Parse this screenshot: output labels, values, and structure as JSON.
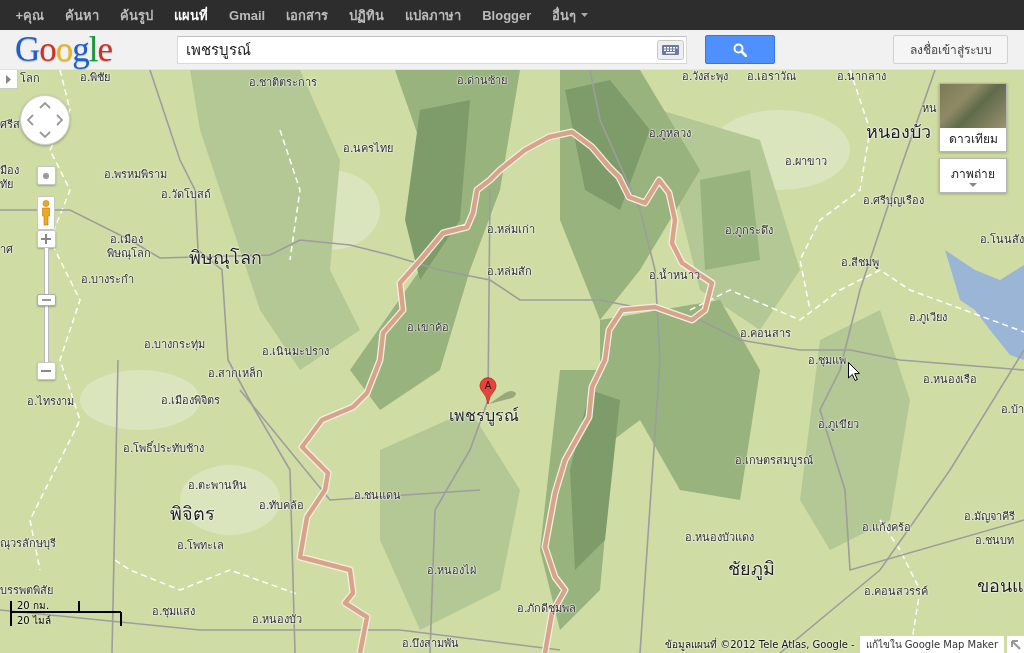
{
  "top_bar": {
    "items": [
      {
        "label": "+คุณ",
        "selected": false,
        "kind": "link"
      },
      {
        "label": "ค้นหา",
        "selected": false,
        "kind": "link"
      },
      {
        "label": "ค้นรูป",
        "selected": false,
        "kind": "link"
      },
      {
        "label": "แผนที่",
        "selected": true,
        "kind": "link"
      },
      {
        "label": "Gmail",
        "selected": false,
        "kind": "link"
      },
      {
        "label": "เอกสาร",
        "selected": false,
        "kind": "link"
      },
      {
        "label": "ปฏิทิน",
        "selected": false,
        "kind": "link"
      },
      {
        "label": "แปลภาษา",
        "selected": false,
        "kind": "link"
      },
      {
        "label": "Blogger",
        "selected": false,
        "kind": "link"
      },
      {
        "label": "อื่นๆ",
        "selected": false,
        "kind": "menu"
      }
    ]
  },
  "header": {
    "logo": "Google",
    "search": {
      "value": "เพชรบูรณ์"
    },
    "sign_in": "ลงชื่อเข้าสู่ระบบ"
  },
  "map": {
    "labels": [
      {
        "text": "โลก",
        "kind": "district"
      },
      {
        "text": "อ.พิชัย",
        "kind": "district"
      },
      {
        "text": "อ.ชาติตระการ",
        "kind": "district"
      },
      {
        "text": "อ.ด่านซ้าย",
        "kind": "district"
      },
      {
        "text": "อ.วังสะพุง",
        "kind": "district"
      },
      {
        "text": "อ.เอราวัณ",
        "kind": "district"
      },
      {
        "text": "อ.นากลาง",
        "kind": "district"
      },
      {
        "text": "หน",
        "kind": "district"
      },
      {
        "text": "ศรีส",
        "kind": "district"
      },
      {
        "text": "อ.ภูหลวง",
        "kind": "district"
      },
      {
        "text": "หนองบัว",
        "kind": "province"
      },
      {
        "text": "อ.นครไทย",
        "kind": "district"
      },
      {
        "text": "อ.ผาขาว",
        "kind": "district"
      },
      {
        "text": "มือง",
        "kind": "district"
      },
      {
        "text": "อ.พรหมพิราม",
        "kind": "district"
      },
      {
        "text": "ทัย",
        "kind": "district"
      },
      {
        "text": "อ.วัดโบสถ์",
        "kind": "district"
      },
      {
        "text": "อ.ศรีบุญเรือง",
        "kind": "district"
      },
      {
        "text": "อ.หล่มเก่า",
        "kind": "district"
      },
      {
        "text": "อ.ภูกระดึง",
        "kind": "district"
      },
      {
        "text": "อ.เมือง",
        "kind": "district"
      },
      {
        "text": "อ.โนนสัง",
        "kind": "district"
      },
      {
        "text": "าศ",
        "kind": "district"
      },
      {
        "text": "พิษณุโลก",
        "kind": "district"
      },
      {
        "text": "พิษณุโลก",
        "kind": "province"
      },
      {
        "text": "อ.สีชมพู",
        "kind": "district"
      },
      {
        "text": "อ.บางระกำ",
        "kind": "district"
      },
      {
        "text": "อ.หล่มสัก",
        "kind": "district"
      },
      {
        "text": "อ.น้ำหนาว",
        "kind": "district"
      },
      {
        "text": "อ.ภูเวียง",
        "kind": "district"
      },
      {
        "text": "อ.เขาค้อ",
        "kind": "district"
      },
      {
        "text": "อ.คอนสาร",
        "kind": "district"
      },
      {
        "text": "อ.บางกระทุ่ม",
        "kind": "district"
      },
      {
        "text": "อ.เนินมะปราง",
        "kind": "district"
      },
      {
        "text": "อ.ชุมแพ",
        "kind": "district"
      },
      {
        "text": "อ.สากเหล็ก",
        "kind": "district"
      },
      {
        "text": "อ.หนองเรือ",
        "kind": "district"
      },
      {
        "text": "อ.ไทรงาม",
        "kind": "district"
      },
      {
        "text": "อ.เมืองพิจิตร",
        "kind": "district"
      },
      {
        "text": "เพชรบูรณ์",
        "kind": "city"
      },
      {
        "text": "อ.บ้า",
        "kind": "district"
      },
      {
        "text": "อ.ภูเขียว",
        "kind": "district"
      },
      {
        "text": "อ.โพธิ์ประทับช้าง",
        "kind": "district"
      },
      {
        "text": "อ.เกษตรสมบูรณ์",
        "kind": "district"
      },
      {
        "text": "อ.ตะพานหิน",
        "kind": "district"
      },
      {
        "text": "อ.ชนแดน",
        "kind": "district"
      },
      {
        "text": "พิจิตร",
        "kind": "province"
      },
      {
        "text": "อ.ทับคล้อ",
        "kind": "district"
      },
      {
        "text": "อ.มัญจาคีรี",
        "kind": "district"
      },
      {
        "text": "อ.แก้งคร้อ",
        "kind": "district"
      },
      {
        "text": "ณุวรลักษบุรี",
        "kind": "district"
      },
      {
        "text": "อ.โพทะเล",
        "kind": "district"
      },
      {
        "text": "อ.หนองบัวแดง",
        "kind": "district"
      },
      {
        "text": "อ.ชนบท",
        "kind": "district"
      },
      {
        "text": "อ.หนองไผ่",
        "kind": "district"
      },
      {
        "text": "ชัยภูมิ",
        "kind": "province"
      },
      {
        "text": "บรรพตพิสัย",
        "kind": "district"
      },
      {
        "text": "อ.คอนสวรรค์",
        "kind": "district"
      },
      {
        "text": "ขอนแ",
        "kind": "province"
      },
      {
        "text": "อ.ชุมแสง",
        "kind": "district"
      },
      {
        "text": "อ.ภักดีชุมพล",
        "kind": "district"
      },
      {
        "text": "อ.หนองบัว",
        "kind": "district"
      },
      {
        "text": "อ.บึงสามพัน",
        "kind": "district"
      }
    ],
    "marker": {
      "label": "A"
    },
    "zoom_slider": {
      "level": 0.55
    },
    "map_types": [
      {
        "label": "ดาวเทียม",
        "kind": "thumbnail"
      },
      {
        "label": "ภาพถ่าย",
        "kind": "dropdown"
      }
    ],
    "scale": [
      "20 กม.",
      "20 ไมล์"
    ],
    "attribution": {
      "text": "ข้อมูลแผนที่ ©2012 Tele Atlas, Google -",
      "link": "แก้ไขใน Google Map Maker"
    }
  }
}
